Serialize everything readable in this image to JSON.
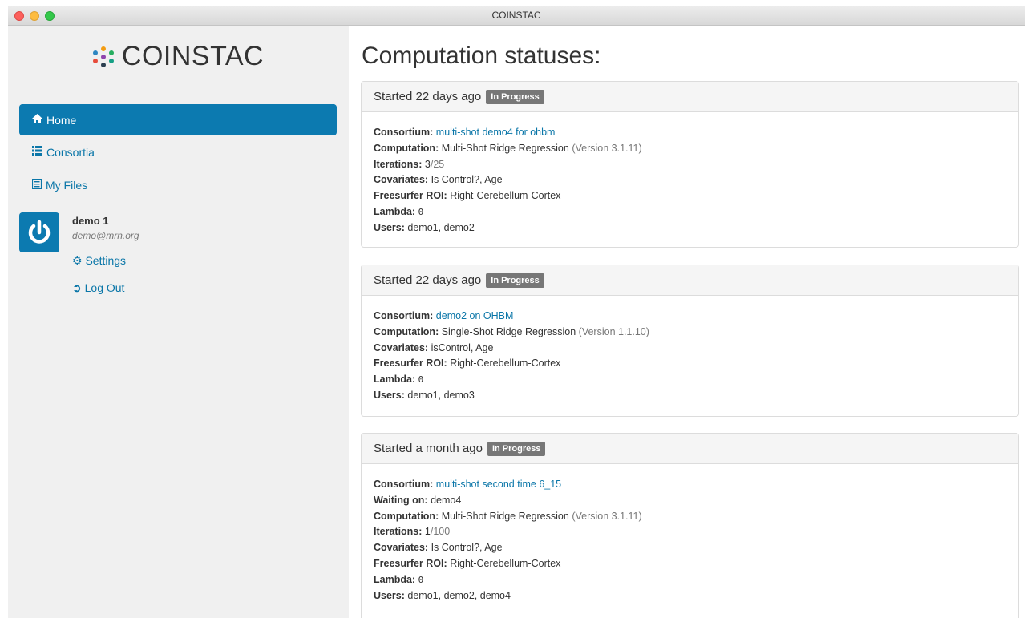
{
  "window": {
    "title": "COINSTAC"
  },
  "sidebar": {
    "brand": "COINSTAC",
    "nav": [
      {
        "label": "Home",
        "icon": "home-icon"
      },
      {
        "label": "Consortia",
        "icon": "list-icon"
      },
      {
        "label": "My Files",
        "icon": "files-icon"
      }
    ],
    "user": {
      "name": "demo 1",
      "email": "demo@mrn.org",
      "settings_label": "Settings",
      "logout_label": "Log Out"
    }
  },
  "main": {
    "title": "Computation statuses:",
    "labels": {
      "consortium": "Consortium:",
      "computation": "Computation:",
      "iterations": "Iterations:",
      "covariates": "Covariates:",
      "roi": "Freesurfer ROI:",
      "lambda": "Lambda:",
      "users": "Users:",
      "waiting": "Waiting on:"
    },
    "computations": [
      {
        "started": "Started 22 days ago",
        "badge": "In Progress",
        "consortium": "multi-shot demo4 for ohbm",
        "computation": "Multi-Shot Ridge Regression",
        "version": "(Version 3.1.11)",
        "iterations_done": "3",
        "iterations_total": "/25",
        "covariates": "Is Control?, Age",
        "roi": "Right-Cerebellum-Cortex",
        "lambda": "0",
        "users": "demo1, demo2"
      },
      {
        "started": "Started 22 days ago",
        "badge": "In Progress",
        "consortium": "demo2 on OHBM",
        "computation": "Single-Shot Ridge Regression",
        "version": "(Version 1.1.10)",
        "covariates": "isControl, Age",
        "roi": "Right-Cerebellum-Cortex",
        "lambda": "0",
        "users": "demo1, demo3"
      },
      {
        "started": "Started a month ago",
        "badge": "In Progress",
        "consortium": "multi-shot second time 6_15",
        "waiting_on": "demo4",
        "computation": "Multi-Shot Ridge Regression",
        "version": "(Version 3.1.11)",
        "iterations_done": "1",
        "iterations_total": "/100",
        "covariates": "Is Control?, Age",
        "roi": "Right-Cerebellum-Cortex",
        "lambda": "0",
        "users": "demo1, demo2, demo4"
      }
    ]
  }
}
